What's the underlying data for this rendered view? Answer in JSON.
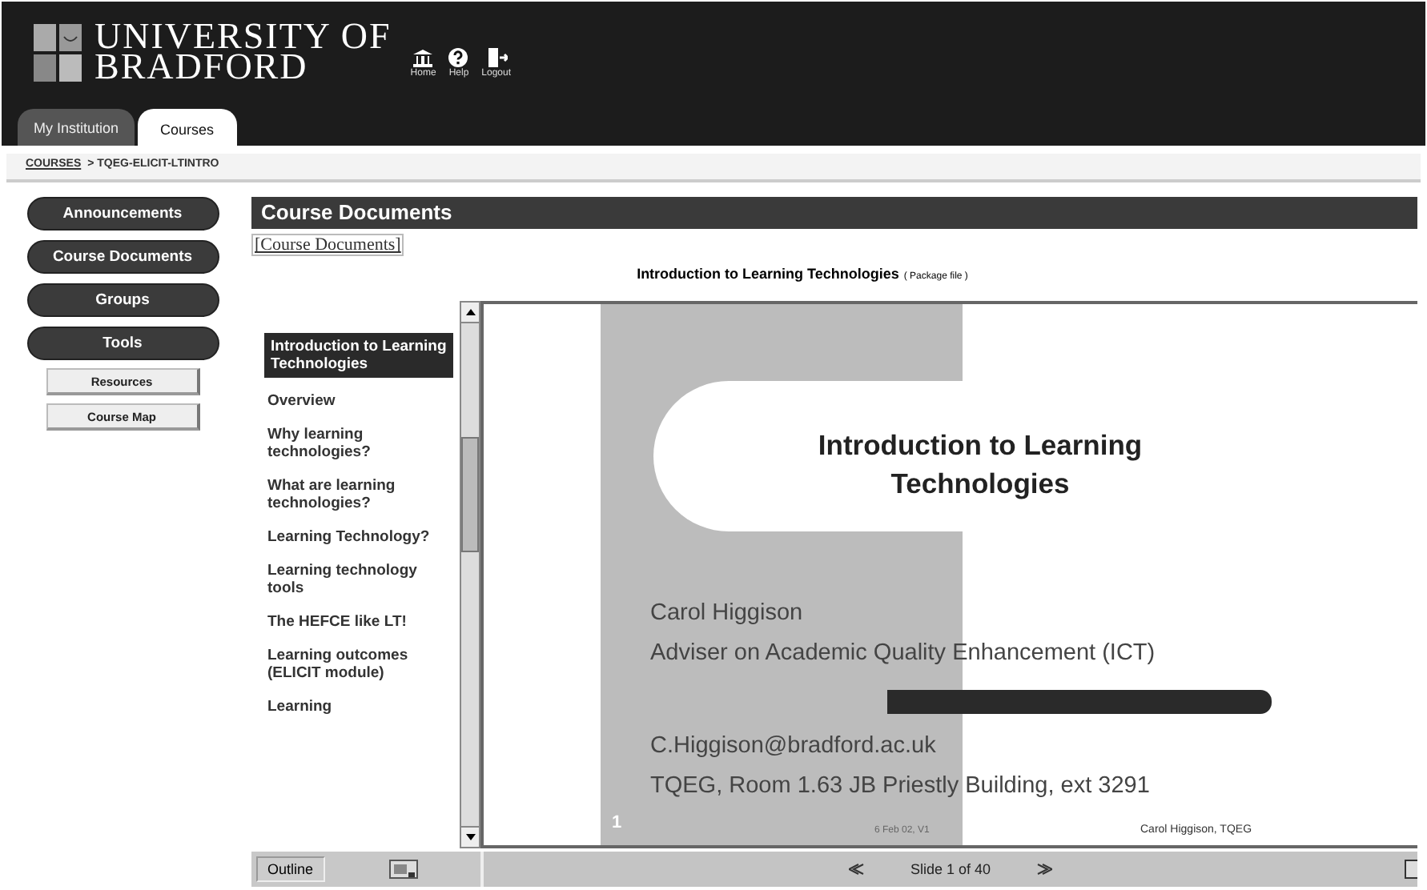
{
  "header": {
    "logo_lines": [
      "UNIVERSITY OF",
      "BRADFORD"
    ],
    "icons": [
      {
        "kind": "home",
        "label": "Home"
      },
      {
        "kind": "help",
        "label": "Help"
      },
      {
        "kind": "logout",
        "label": "Logout"
      }
    ]
  },
  "tabs": [
    {
      "label": "My Institution",
      "selected": false
    },
    {
      "label": "Courses",
      "selected": true
    }
  ],
  "breadcrumb": {
    "link": "COURSES",
    "current": "> TQEG-ELICIT-LTINTRO"
  },
  "sidebar": {
    "items": [
      {
        "label": "Announcements",
        "kind": "pill"
      },
      {
        "label": "Course Documents",
        "kind": "pill"
      },
      {
        "label": "Groups",
        "kind": "pill"
      },
      {
        "label": "Tools",
        "kind": "pill"
      },
      {
        "label": "Resources",
        "kind": "sub"
      },
      {
        "label": "Course Map",
        "kind": "sub"
      }
    ]
  },
  "content": {
    "heading": "Course Documents",
    "path_link": "[Course Documents]",
    "title": "Introduction to Learning Technologies",
    "title_note": "( Package file )"
  },
  "outline": {
    "items": [
      {
        "label": "Introduction to Learning Technologies",
        "selected": true
      },
      {
        "label": "Overview",
        "selected": false
      },
      {
        "label": "Why learning technologies?",
        "selected": false
      },
      {
        "label": "What are learning technologies?",
        "selected": false
      },
      {
        "label": "Learning Technology?",
        "selected": false
      },
      {
        "label": "Learning technology tools",
        "selected": false
      },
      {
        "label": "The HEFCE like LT!",
        "selected": false
      },
      {
        "label": "Learning outcomes (ELICIT module)",
        "selected": false
      },
      {
        "label": "Learning",
        "selected": false
      }
    ],
    "button": "Outline"
  },
  "slide": {
    "title": "Introduction to Learning Technologies",
    "author_lines": [
      "Carol Higgison",
      "Adviser on Academic Quality Enhancement (ICT)"
    ],
    "contact_lines": [
      "C.Higgison@bradford.ac.uk",
      "TQEG, Room 1.63 JB Priestly Building, ext 3291"
    ],
    "number": "1",
    "date": "6 Feb 02, V1",
    "footer": "Carol Higgison, TQEG"
  },
  "nav": {
    "counter": "Slide 1 of 40"
  }
}
